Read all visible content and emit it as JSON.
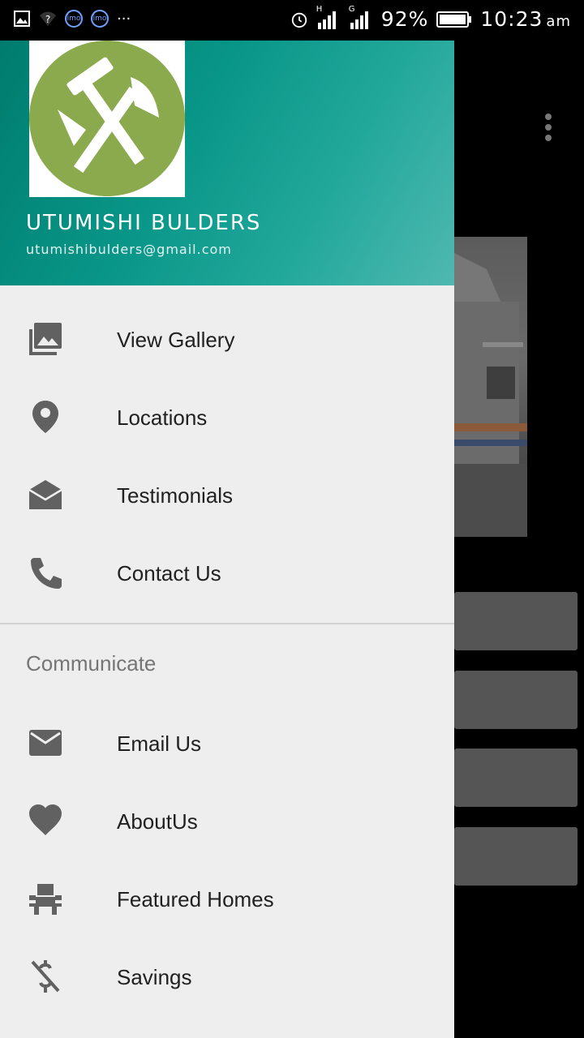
{
  "status_bar": {
    "battery": "92%",
    "time": "10:23",
    "time_suffix": "am",
    "sim1_label": "H",
    "sim2_label": "G",
    "notification_icons": [
      "image-icon",
      "wifi-question-icon",
      "imo-icon",
      "imo-icon",
      "more-notifications-icon"
    ],
    "imo_text": "imo",
    "more": "···"
  },
  "drawer": {
    "header": {
      "title": "UTUMISHI BULDERS",
      "email": "utumishibulders@gmail.com",
      "logo": "tools-logo",
      "colors": {
        "gradient_start": "#007c6e",
        "gradient_end": "#4fb8b0",
        "logo_circle": "#8aaa4d"
      }
    },
    "menu_items": [
      {
        "label": "View Gallery",
        "icon": "gallery-icon"
      },
      {
        "label": "Locations",
        "icon": "location-pin-icon"
      },
      {
        "label": "Testimonials",
        "icon": "open-envelope-icon"
      },
      {
        "label": "Contact Us",
        "icon": "phone-icon"
      }
    ],
    "section_title": "Communicate",
    "communicate_items": [
      {
        "label": "Email Us",
        "icon": "email-icon"
      },
      {
        "label": "AboutUs",
        "icon": "heart-icon"
      },
      {
        "label": "Featured Homes",
        "icon": "seat-icon"
      },
      {
        "label": "Savings",
        "icon": "money-off-icon"
      }
    ]
  },
  "background": {
    "overflow_menu": "more-vert-icon"
  }
}
